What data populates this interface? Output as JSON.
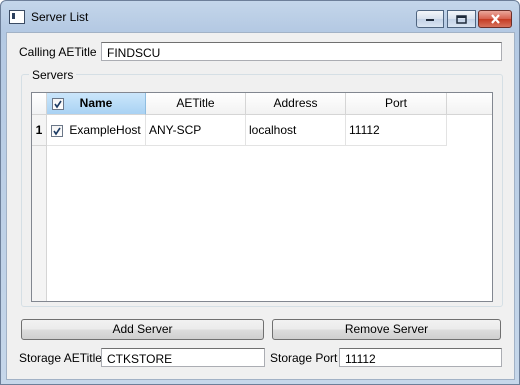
{
  "window": {
    "title": "Server List"
  },
  "calling": {
    "label": "Calling AETitle",
    "value": "FINDSCU"
  },
  "servers": {
    "group_label": "Servers",
    "columns": [
      "Name",
      "AETitle",
      "Address",
      "Port"
    ],
    "rows": [
      {
        "num": "1",
        "checked": true,
        "name": "ExampleHost",
        "aetitle": "ANY-SCP",
        "address": "localhost",
        "port": "11112"
      }
    ]
  },
  "buttons": {
    "add": "Add Server",
    "remove": "Remove Server"
  },
  "storage": {
    "aetitle_label": "Storage AETitle",
    "aetitle_value": "CTKSTORE",
    "port_label": "Storage Port",
    "port_value": "11112"
  }
}
